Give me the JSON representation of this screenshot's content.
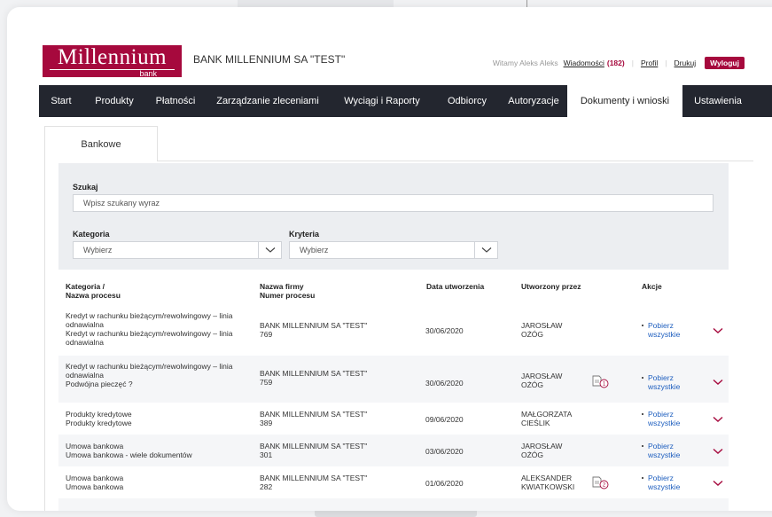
{
  "header": {
    "logo_text": "Millennium",
    "logo_sub": "bank",
    "bank_name": "BANK MILLENNIUM SA \"TEST\"",
    "greeting": "Witamy Aleks Aleks",
    "messages_label": "Wiadomości",
    "messages_count": "(182)",
    "profile_label": "Profil",
    "print_label": "Drukuj",
    "logout_label": "Wyloguj"
  },
  "nav": {
    "items": [
      {
        "label": "Start"
      },
      {
        "label": "Produkty"
      },
      {
        "label": "Płatności"
      },
      {
        "label": "Zarządzanie zleceniami"
      },
      {
        "label": "Wyciągi i Raporty"
      },
      {
        "label": "Odbiorcy"
      },
      {
        "label": "Autoryzacje"
      },
      {
        "label": "Dokumenty i wnioski"
      },
      {
        "label": "Ustawienia"
      }
    ],
    "active": "Dokumenty i wnioski"
  },
  "tab": {
    "label": "Bankowe"
  },
  "search": {
    "label": "Szukaj",
    "placeholder": "Wpisz szukany wyraz",
    "category_label": "Kategoria",
    "category_value": "Wybierz",
    "criteria_label": "Kryteria",
    "criteria_value": "Wybierz"
  },
  "table": {
    "headers": {
      "category_1": "Kategoria /",
      "category_2": "Nazwa procesu",
      "company_1": "Nazwa firmy",
      "company_2": "Numer procesu",
      "date": "Data utworzenia",
      "created_by": "Utworzony przez",
      "actions": "Akcje"
    },
    "rows": [
      {
        "cat_lines": [
          "Kredyt w rachunku bieżącym/rewolwingowy – linia",
          "odnawialna",
          "Kredyt w rachunku bieżącym/rewolwingowy – linia",
          "odnawialna"
        ],
        "company": "BANK MILLENNIUM SA \"TEST\"",
        "number": "769",
        "date": "30/06/2020",
        "user_1": "JAROSŁAW",
        "user_2": "OŻÓG",
        "badge": "",
        "action_1": "Pobierz",
        "action_2": "wszystkie"
      },
      {
        "cat_lines": [
          "Kredyt w rachunku bieżącym/rewolwingowy – linia",
          "odnawialna",
          "Podwójna pieczęć ?"
        ],
        "company": "BANK MILLENNIUM SA \"TEST\"",
        "number": "759",
        "date": "30/06/2020",
        "user_1": "JAROSŁAW",
        "user_2": "OŻÓG",
        "badge": "1",
        "action_1": "Pobierz",
        "action_2": "wszystkie"
      },
      {
        "cat_lines": [
          "Produkty kredytowe",
          "Produkty kredytowe"
        ],
        "company": "BANK MILLENNIUM SA \"TEST\"",
        "number": "389",
        "date": "09/06/2020",
        "user_1": "MAŁGORZATA",
        "user_2": "CIEŚLIK",
        "badge": "",
        "action_1": "Pobierz",
        "action_2": "wszystkie"
      },
      {
        "cat_lines": [
          "Umowa bankowa",
          "Umowa bankowa - wiele dokumentów"
        ],
        "company": "BANK MILLENNIUM SA \"TEST\"",
        "number": "301",
        "date": "03/06/2020",
        "user_1": "JAROSŁAW",
        "user_2": "OŻÓG",
        "badge": "",
        "action_1": "Pobierz",
        "action_2": "wszystkie"
      },
      {
        "cat_lines": [
          "Umowa bankowa",
          "Umowa bankowa"
        ],
        "company": "BANK MILLENNIUM SA \"TEST\"",
        "number": "282",
        "date": "01/06/2020",
        "user_1": "ALEKSANDER",
        "user_2": "KWIATKOWSKI",
        "badge": "2",
        "action_1": "Pobierz",
        "action_2": "wszystkie"
      }
    ]
  },
  "colors": {
    "brand": "#a6093d",
    "nav_bg": "#23262f",
    "link": "#1f5fbf"
  },
  "icons": [
    "chevron-down-icon",
    "document-badge-icon"
  ]
}
